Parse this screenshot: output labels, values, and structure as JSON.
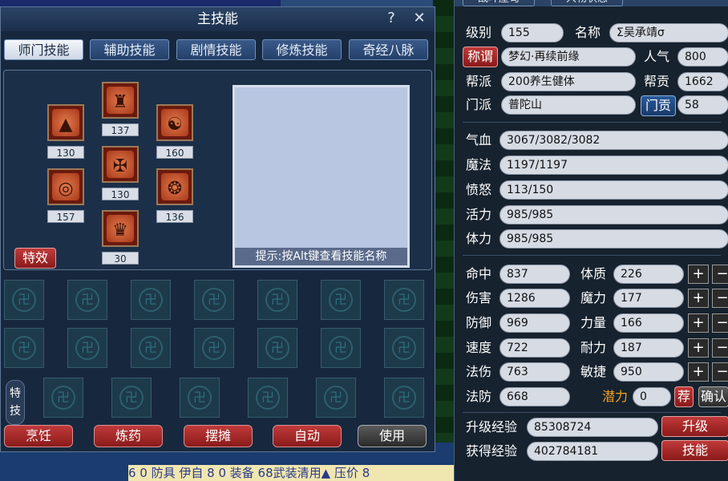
{
  "skill_window": {
    "title": "主技能",
    "help_label": "?",
    "close_label": "✕",
    "tabs": [
      "师门技能",
      "辅助技能",
      "剧情技能",
      "修炼技能",
      "奇经八脉"
    ],
    "skills": [
      {
        "icon": "stupa-icon",
        "glyph": "▲",
        "level": "130"
      },
      {
        "icon": "demon-mask-icon",
        "glyph": "♜",
        "level": "137"
      },
      {
        "icon": "head-profile-icon",
        "glyph": "☯",
        "level": "160"
      },
      {
        "icon": "sword-cross-icon",
        "glyph": "✠",
        "level": "130"
      },
      {
        "icon": "seal-disc-icon",
        "glyph": "◎",
        "level": "157"
      },
      {
        "icon": "wheel-icon",
        "glyph": "❂",
        "level": "136"
      },
      {
        "icon": "crown-teeth-icon",
        "glyph": "♛",
        "level": "30"
      }
    ],
    "tip_text": "提示:按Alt键查看技能名称",
    "effect_label": "特效",
    "special_label": "特技",
    "actions": [
      "烹饪",
      "炼药",
      "摆摊",
      "自动",
      "使用"
    ]
  },
  "char_panel": {
    "tabs": [
      "战斗屋甸",
      "人物状态"
    ],
    "level_label": "级别",
    "level": "155",
    "name_label": "名称",
    "name": "Σ吴承靖σ",
    "title_btn": "称谓",
    "title_value": "梦幻·再续前缘",
    "pop_label": "人气",
    "pop": "800",
    "gang_label": "帮派",
    "gang": "200养生健体",
    "gang_contrib_label": "帮贡",
    "gang_contrib": "1662",
    "sect_label": "门派",
    "sect": "普陀山",
    "sect_contrib_btn": "门贡",
    "sect_contrib": "58",
    "hp_label": "气血",
    "hp": "3067/3082/3082",
    "mp_label": "魔法",
    "mp": "1197/1197",
    "anger_label": "愤怒",
    "anger": "113/150",
    "vitality_label": "活力",
    "vitality": "985/985",
    "stamina_label": "体力",
    "stamina": "985/985",
    "stats_left": [
      {
        "label": "命中",
        "value": "837"
      },
      {
        "label": "伤害",
        "value": "1286"
      },
      {
        "label": "防御",
        "value": "969"
      },
      {
        "label": "速度",
        "value": "722"
      },
      {
        "label": "法伤",
        "value": "763"
      },
      {
        "label": "法防",
        "value": "668"
      }
    ],
    "stats_right": [
      {
        "label": "体质",
        "value": "226"
      },
      {
        "label": "魔力",
        "value": "177"
      },
      {
        "label": "力量",
        "value": "166"
      },
      {
        "label": "耐力",
        "value": "187"
      },
      {
        "label": "敏捷",
        "value": "950"
      }
    ],
    "potential_label": "潜力",
    "potential": "0",
    "save_btn": "荐",
    "confirm_btn": "确认",
    "upgrade_exp_label": "升级经验",
    "upgrade_exp": "85308724",
    "upgrade_btn": "升级",
    "gained_exp_label": "获得经验",
    "gained_exp": "402784181",
    "skill_btn": "技能"
  },
  "background": {
    "bottom_text": "6 0 防具  伊自 8 0 装备   68武装清用▲   压价 8"
  }
}
